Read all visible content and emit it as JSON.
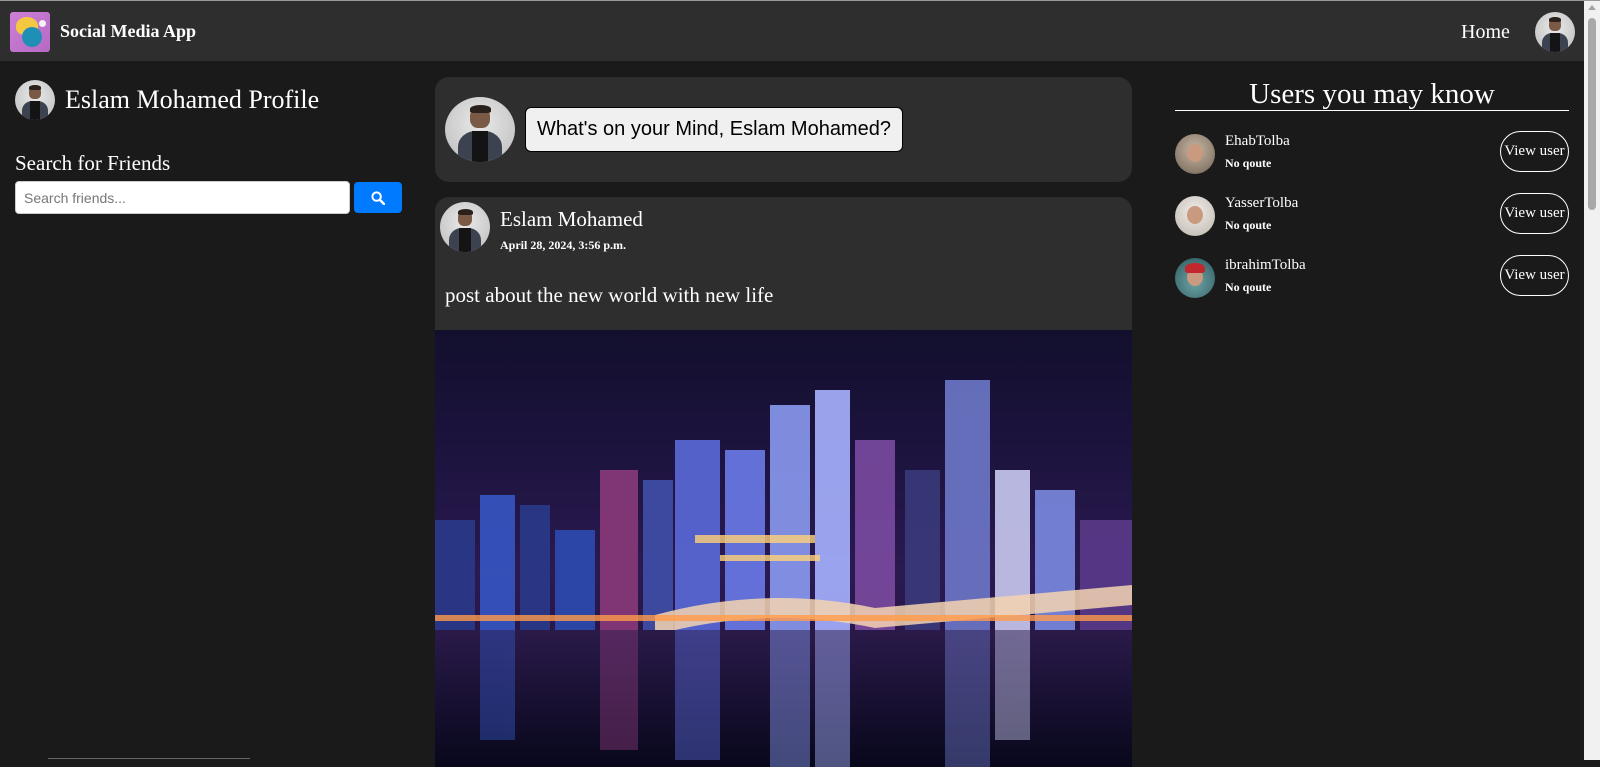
{
  "navbar": {
    "brand": "Social Media App",
    "home_label": "Home",
    "logo_icon": "app-logo-icon",
    "avatar_icon": "user-avatar-icon"
  },
  "left": {
    "profile_link": "Eslam Mohamed Profile",
    "search_title": "Search for Friends",
    "search_placeholder": "Search friends...",
    "search_value": "",
    "search_button_icon": "search-icon",
    "search_button_color": "#007bff"
  },
  "composer": {
    "prompt": "What's on your Mind, Eslam Mohamed?"
  },
  "post": {
    "author": "Eslam Mohamed",
    "date": "April 28, 2024, 3:56 p.m.",
    "text": "post about the new world with new life",
    "image_alt": "city skyline at night with reflections"
  },
  "suggestions": {
    "title": "Users you may know",
    "users": [
      {
        "name": "EhabTolba",
        "quote": "No qoute",
        "button": "View user"
      },
      {
        "name": "YasserTolba",
        "quote": "No qoute",
        "button": "View user"
      },
      {
        "name": "ibrahimTolba",
        "quote": "No qoute",
        "button": "View user"
      }
    ]
  },
  "colors": {
    "background": "#1a1a1a",
    "panel": "#2e2e2e",
    "accent": "#007bff"
  }
}
